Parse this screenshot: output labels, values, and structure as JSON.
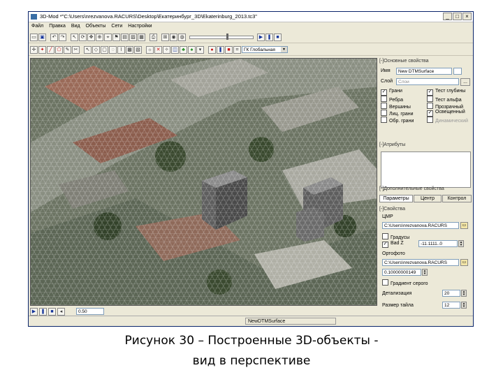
{
  "window": {
    "title": "3D-Mod *\"C:\\Users\\nrezvanova.RACURS\\Desktop\\Екатеринбург_3D\\Ekaterinburg_2013.tc3\"",
    "controls": [
      "_",
      "□",
      "×"
    ]
  },
  "menu": [
    "Файл",
    "Правка",
    "Вид",
    "Объекты",
    "Сети",
    "Настройки"
  ],
  "toolbar": {
    "zoom_combo": "ГК Глобальная"
  },
  "panel": {
    "main_props": {
      "header": "[-]Основные свойства",
      "name_label": "Имя",
      "name_value": "New DTMSurface",
      "layer_label": "Слой",
      "layer_value": "Слои",
      "layer_btn": "...",
      "checks_left": [
        {
          "label": "Грани",
          "checked": true
        },
        {
          "label": "Ребра",
          "checked": false
        },
        {
          "label": "Вершины",
          "checked": false
        },
        {
          "label": "Лиц. грани",
          "checked": false
        },
        {
          "label": "Обр. грани",
          "checked": false
        }
      ],
      "checks_right": [
        {
          "label": "Тест глубины",
          "checked": true
        },
        {
          "label": "Тест альфа",
          "checked": false
        },
        {
          "label": "Прозрачный",
          "checked": false
        },
        {
          "label": "Освещенный",
          "checked": true
        },
        {
          "label": "Динамический",
          "checked": false
        }
      ]
    },
    "attributes": {
      "header": "[-]Атрибуты"
    },
    "extra_props": {
      "header": "[-]Дополнительные свойства",
      "tabs": [
        "Параметры",
        "Центр",
        "Контрол"
      ]
    },
    "props": {
      "header": "[-]Свойства",
      "dem_label": "ЦМР",
      "dem_path": "C:\\Users\\nrezvanova.RACURS",
      "gradient_label": "Градусы",
      "badz_label": "Bad Z",
      "badz_value": "-11.1111..0",
      "ortho_label": "Ортофото",
      "ortho_path": "C:\\Users\\nrezvanova.RACURS",
      "ortho_value": "0.10000000149",
      "gradient2_label": "Градиент серого",
      "detail_label": "Детализация",
      "detail_value": "20",
      "tile_label": "Размер тайла",
      "tile_value": "12"
    }
  },
  "bottom": {
    "speed_value": "0.50"
  },
  "status": {
    "object": "NewDTMSurface"
  },
  "caption": {
    "line1": "Рисунок 30 – Построенные 3D-объекты -",
    "line2": "вид в перспективе"
  }
}
